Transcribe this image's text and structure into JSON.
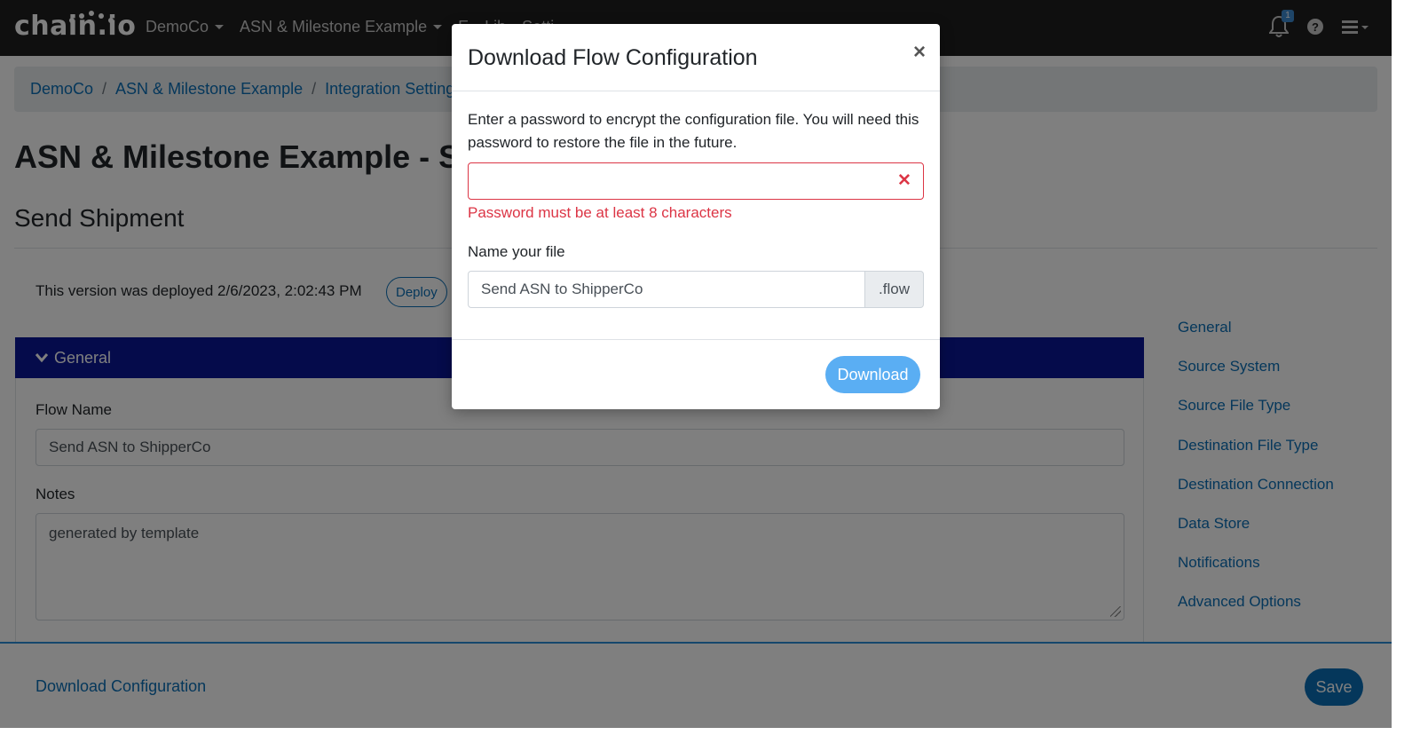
{
  "navbar": {
    "brand": "chain.io",
    "menus": [
      {
        "label": "DemoCo"
      },
      {
        "label": "ASN & Milestone Example"
      },
      {
        "label": "E"
      },
      {
        "label": "Lib"
      },
      {
        "label": "Setti"
      }
    ],
    "notification_count": "1",
    "icons": [
      "bell-icon",
      "help-icon",
      "hamburger-menu-icon"
    ]
  },
  "breadcrumb": {
    "items": [
      "DemoCo",
      "ASN & Milestone Example",
      "Integration Settings"
    ],
    "separator": "/"
  },
  "page": {
    "title": "ASN & Milestone Example - Ser",
    "subtitle": "Send Shipment",
    "deploy_info": "This version was deployed 2/6/2023, 2:02:43 PM",
    "deploy_button": "Deploy"
  },
  "section": {
    "header": "General",
    "flow_name_label": "Flow Name",
    "flow_name_value": "Send ASN to ShipperCo",
    "notes_label": "Notes",
    "notes_value": "generated by template"
  },
  "side_nav": {
    "items": [
      "General",
      "Source System",
      "Source File Type",
      "Destination File Type",
      "Destination Connection",
      "Data Store",
      "Notifications",
      "Advanced Options"
    ]
  },
  "footer": {
    "download_config": "Download Configuration",
    "save": "Save"
  },
  "modal": {
    "title": "Download Flow Configuration",
    "close": "×",
    "description": "Enter a password to encrypt the configuration file. You will need this password to restore the file in the future.",
    "password_value": "",
    "error": "Password must be at least 8 characters",
    "file_label": "Name your file",
    "file_value": "Send ASN to ShipperCo",
    "file_suffix": ".flow",
    "download_button": "Download"
  },
  "colors": {
    "navbar_bg": "#1f1f1f",
    "link": "#0a6fb6",
    "section_header_bg": "#0b1696",
    "error": "#dc3545",
    "download_button": "#5aaef3"
  }
}
